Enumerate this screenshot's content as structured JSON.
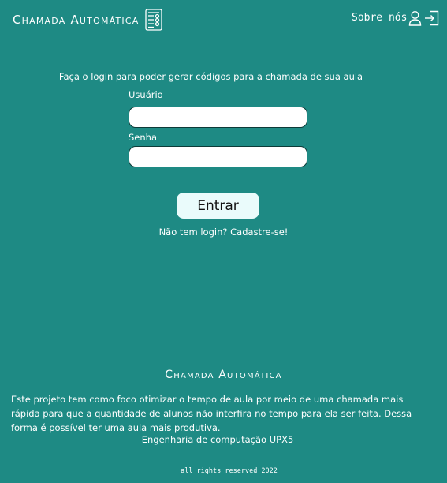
{
  "header": {
    "brand_title": "Chamada Automática",
    "brand_icon": "checklist-document-icon",
    "nav_about": "Sobre nós",
    "user_icon": "user-icon",
    "login_icon": "login-door-icon"
  },
  "login": {
    "intro": "Faça o login para poder gerar códigos para a chamada de sua aula",
    "user_label": "Usuário",
    "user_value": "",
    "pass_label": "Senha",
    "pass_value": "",
    "submit_label": "Entrar",
    "signup_link": "Não tem login? Cadastre-se!"
  },
  "footer": {
    "title": "Chamada Automática",
    "description": "Este projeto tem como foco otimizar o tempo de aula por meio de uma chamada mais rápida para que a quantidade de alunos não interfira no tempo para ela ser feita. Dessa forma é possível ter uma aula mais produtiva.",
    "course": "Engenharia de computação UPX5",
    "rights": "all rights reserved 2022"
  },
  "colors": {
    "background": "#1e8a84",
    "text": "#ffffff",
    "button_bg": "#eafbfb",
    "input_border": "#0d3b38"
  }
}
